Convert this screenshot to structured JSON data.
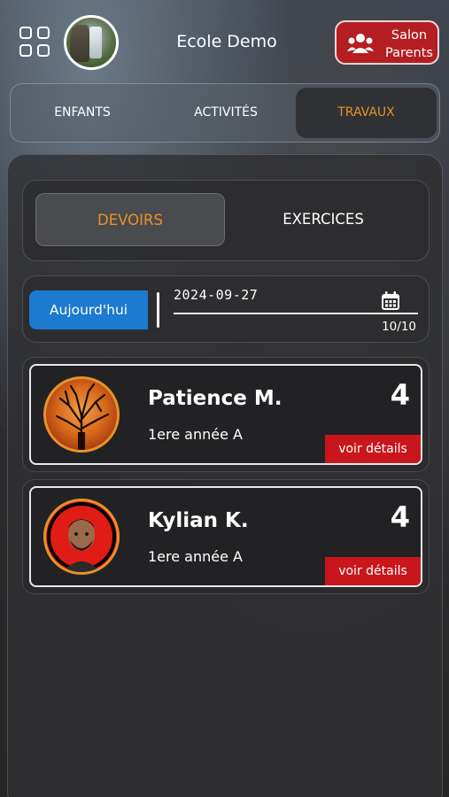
{
  "header": {
    "school_name": "Ecole Demo",
    "salon_button": {
      "line1": "Salon",
      "line2": "Parents"
    }
  },
  "main_tabs": [
    {
      "label": "ENFANTS",
      "active": false
    },
    {
      "label": "ACTIVITÉS",
      "active": false
    },
    {
      "label": "TRAVAUX",
      "active": true
    }
  ],
  "sub_tabs": [
    {
      "label": "DEVOIRS",
      "active": true
    },
    {
      "label": "EXERCICES",
      "active": false
    }
  ],
  "date_filter": {
    "today_label": "Aujourd'hui",
    "date": "2024-09-27",
    "count": "10/10"
  },
  "students": [
    {
      "name": "Patience M.",
      "class": "1ere année A",
      "count": "4",
      "details_label": "voir détails",
      "avatar": "tree-avatar"
    },
    {
      "name": "Kylian K.",
      "class": "1ere année A",
      "count": "4",
      "details_label": "voir détails",
      "avatar": "person-avatar"
    }
  ],
  "colors": {
    "accent_orange": "#e8912a",
    "salon_red": "#b41e22",
    "today_blue": "#1c7ad0",
    "details_red": "#c8161c"
  }
}
